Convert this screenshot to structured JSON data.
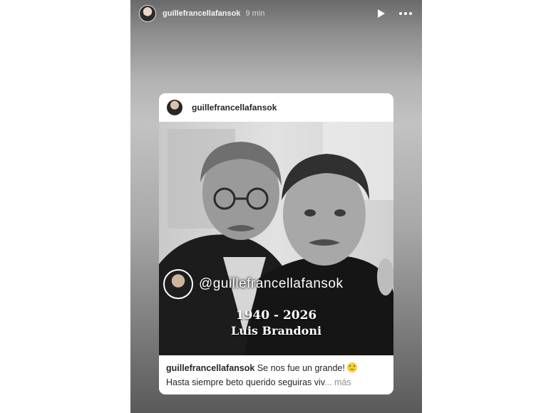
{
  "story": {
    "username": "guillefrancellafansok",
    "time_ago": "9 min",
    "play_icon": "play-icon",
    "more_icon": "more-horizontal-icon"
  },
  "post": {
    "username": "guillefrancellafansok",
    "watermark": "@guillefrancellafansok",
    "years": "1940 - 2026",
    "name": "Luis Brandoni",
    "caption_text": "Se nos fue un grande!",
    "caption_line2": "Hasta siempre beto querido seguiras viv",
    "ellipsis": "...",
    "more_label": "más",
    "emoji": "sad-face-emoji"
  },
  "colors": {
    "caption_text": "#262626",
    "muted": "#8e8e8e",
    "card_bg": "#ffffff"
  }
}
